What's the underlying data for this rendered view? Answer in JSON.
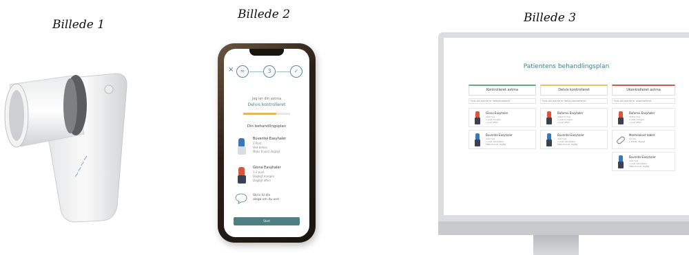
{
  "captions": {
    "image1": "Billede 1",
    "image2": "Billede 2",
    "image3": "Billede 3"
  },
  "colors": {
    "teal": "#3f7f82",
    "button": "#4d7f83",
    "progress": "#e8b45a",
    "green": "#5fae74",
    "yellow": "#e8c25a",
    "red": "#c85a4a",
    "inhaler_blue": "#3a78b5",
    "inhaler_red": "#d8553e"
  },
  "phone": {
    "close": "×",
    "step_number": "3",
    "status_small": "Jeg ler din astma",
    "status_main": "Delvis kontrolleret",
    "progress": 0.7,
    "section": "Din behandlingsplan",
    "meds": [
      {
        "name": "Buventol Easyhaler",
        "dose": [
          "2 Pust",
          "Ved behov",
          "Maks 8 pust dagligt"
        ]
      },
      {
        "name": "Giona Easyhaler",
        "dose": [
          "1-2 pust",
          "Dagligt morgen",
          "Dagligt aften"
        ]
      }
    ],
    "note": [
      "Skriv til din",
      "alege om du ved"
    ],
    "button": "Start"
  },
  "monitor": {
    "title": "Patientens behandlingsplan",
    "columns": [
      {
        "header": "Kontrolleret astma",
        "sub": "Hvis din astma er velkontrolleret"
      },
      {
        "header": "Delvis kontrolleret",
        "sub": "Hvis din astma er delvis kontrolleret"
      },
      {
        "header": "Ukontrolleret astma",
        "sub": "Hvis din astma er ukontrolleret"
      }
    ],
    "cards": [
      [
        {
          "name": "Giona Easyhaler",
          "dose": [
            "200 mcg",
            "1 pust morgen",
            "1 pust aften"
          ]
        },
        {
          "name": "Buventol Easyhaler",
          "dose": [
            "100 mcg",
            "1 pust ved behov",
            "Maks 8 pust dagligt"
          ]
        }
      ],
      [
        {
          "name": "Bufomix Easyhaler",
          "dose": [
            "160/4.5 mcg",
            "1 pust morgen",
            "1 pust aften"
          ]
        },
        {
          "name": "Buventol Easyhaler",
          "dose": [
            "100 mcg",
            "1 pust ved behov",
            "Maks 8 pust dagligt"
          ]
        }
      ],
      [
        {
          "name": "Bufomix Easyhaler",
          "dose": [
            "320/9 mcg",
            "1 pust morgen",
            "1 pust aften"
          ]
        },
        {
          "name": "Montelukast tablet",
          "dose": [
            "10 mg",
            "1 tablet dagligt"
          ]
        },
        {
          "name": "Buventol Easyhaler",
          "dose": [
            "100 mcg",
            "1 pust ved behov",
            "Maks 8 pust dagligt"
          ]
        }
      ]
    ]
  }
}
